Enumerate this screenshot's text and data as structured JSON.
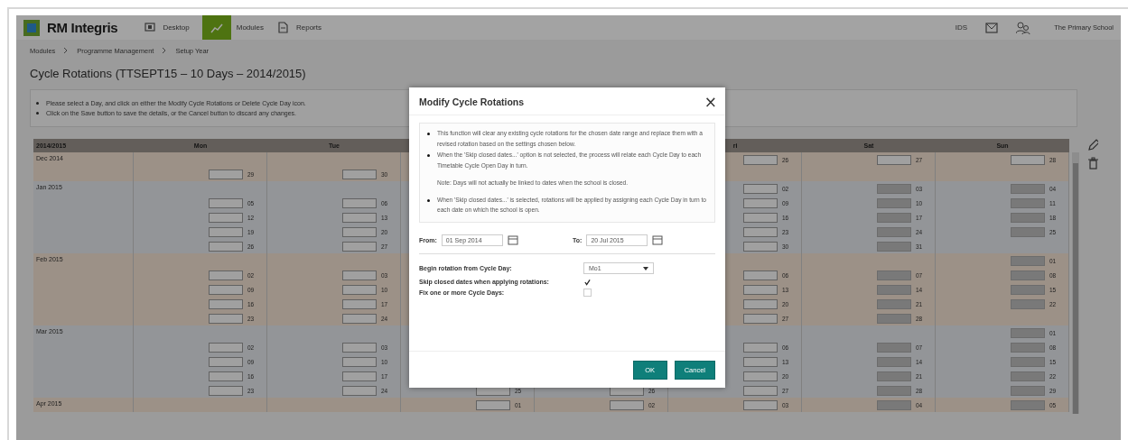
{
  "header": {
    "app_name": "RM Integris",
    "nav": [
      {
        "label": "Desktop",
        "kind": "desktop",
        "selected": false
      },
      {
        "label": "Modules",
        "kind": "modules",
        "selected": true
      },
      {
        "label": "Reports",
        "kind": "reports",
        "selected": false
      }
    ],
    "user_code": "IDS",
    "school": "The Primary School"
  },
  "breadcrumb": [
    "Modules",
    "Programme Management",
    "Setup Year"
  ],
  "page_title": "Cycle Rotations (TTSEPT15 – 10 Days – 2014/2015)",
  "instructions": [
    "Please select a Day, and click on either the Modify Cycle Rotations or Delete Cycle Day icon.",
    "Click on the Save button to save the details, or the Cancel button to discard any changes."
  ],
  "calendar": {
    "corner": "2014/2015",
    "columns": {
      "mon": "Mon",
      "tue": "Tue",
      "fri": "ri",
      "sat": "Sat",
      "sun": "Sun"
    },
    "months": [
      {
        "label": "Dec 2014",
        "weeks": [
          {
            "fri": {
              "day": "26",
              "closed": false
            },
            "sat": {
              "day": "27",
              "closed": false
            },
            "sun": {
              "day": "28",
              "closed": false
            }
          },
          {
            "mon": {
              "day": "29",
              "closed": false
            },
            "tue": {
              "day": "30",
              "closed": false
            }
          }
        ]
      },
      {
        "label": "Jan 2015",
        "weeks": [
          {
            "fri": {
              "day": "02",
              "closed": false
            },
            "sat": {
              "day": "03",
              "closed": true
            },
            "sun": {
              "day": "04",
              "closed": true
            }
          },
          {
            "mon": {
              "day": "05",
              "closed": false
            },
            "tue": {
              "day": "06",
              "closed": false
            },
            "fri": {
              "day": "09",
              "closed": false
            },
            "sat": {
              "day": "10",
              "closed": true
            },
            "sun": {
              "day": "11",
              "closed": true
            }
          },
          {
            "mon": {
              "day": "12",
              "closed": false
            },
            "tue": {
              "day": "13",
              "closed": false
            },
            "fri": {
              "day": "16",
              "closed": false
            },
            "sat": {
              "day": "17",
              "closed": true
            },
            "sun": {
              "day": "18",
              "closed": true
            }
          },
          {
            "mon": {
              "day": "19",
              "closed": false
            },
            "tue": {
              "day": "20",
              "closed": false
            },
            "fri": {
              "day": "23",
              "closed": false
            },
            "sat": {
              "day": "24",
              "closed": true
            },
            "sun": {
              "day": "25",
              "closed": true
            }
          },
          {
            "mon": {
              "day": "26",
              "closed": false
            },
            "tue": {
              "day": "27",
              "closed": false
            },
            "fri": {
              "day": "30",
              "closed": false
            },
            "sat": {
              "day": "31",
              "closed": true
            }
          }
        ]
      },
      {
        "label": "Feb 2015",
        "weeks": [
          {
            "sun": {
              "day": "01",
              "closed": true
            }
          },
          {
            "mon": {
              "day": "02",
              "closed": false
            },
            "tue": {
              "day": "03",
              "closed": false
            },
            "fri": {
              "day": "06",
              "closed": false
            },
            "sat": {
              "day": "07",
              "closed": true
            },
            "sun": {
              "day": "08",
              "closed": true
            }
          },
          {
            "mon": {
              "day": "09",
              "closed": false
            },
            "tue": {
              "day": "10",
              "closed": false
            },
            "fri": {
              "day": "13",
              "closed": false
            },
            "sat": {
              "day": "14",
              "closed": true
            },
            "sun": {
              "day": "15",
              "closed": true
            }
          },
          {
            "mon": {
              "day": "16",
              "closed": false
            },
            "tue": {
              "day": "17",
              "closed": false
            },
            "fri": {
              "day": "20",
              "closed": false
            },
            "sat": {
              "day": "21",
              "closed": true
            },
            "sun": {
              "day": "22",
              "closed": true
            }
          },
          {
            "mon": {
              "day": "23",
              "closed": false
            },
            "tue": {
              "day": "24",
              "closed": false
            },
            "fri": {
              "day": "27",
              "closed": false
            },
            "sat": {
              "day": "28",
              "closed": true
            }
          }
        ]
      },
      {
        "label": "Mar 2015",
        "weeks": [
          {
            "sun": {
              "day": "01",
              "closed": true
            }
          },
          {
            "mon": {
              "day": "02",
              "closed": false
            },
            "tue": {
              "day": "03",
              "closed": false
            },
            "fri": {
              "day": "06",
              "closed": false
            },
            "sat": {
              "day": "07",
              "closed": true
            },
            "sun": {
              "day": "08",
              "closed": true
            }
          },
          {
            "mon": {
              "day": "09",
              "closed": false
            },
            "tue": {
              "day": "10",
              "closed": false
            },
            "fri": {
              "day": "13",
              "closed": false
            },
            "sat": {
              "day": "14",
              "closed": true
            },
            "sun": {
              "day": "15",
              "closed": true
            }
          },
          {
            "mon": {
              "day": "16",
              "closed": false
            },
            "tue": {
              "day": "17",
              "closed": false
            },
            "fri": {
              "day": "20",
              "closed": false
            },
            "sat": {
              "day": "21",
              "closed": true
            },
            "sun": {
              "day": "22",
              "closed": true
            }
          },
          {
            "mon": {
              "day": "23",
              "closed": false
            },
            "tue": {
              "day": "24",
              "closed": false
            },
            "wed": {
              "day": "25",
              "closed": false
            },
            "thu": {
              "day": "26",
              "closed": false
            },
            "fri": {
              "day": "27",
              "closed": false
            },
            "sat": {
              "day": "28",
              "closed": true
            },
            "sun": {
              "day": "29",
              "closed": true
            }
          }
        ]
      },
      {
        "label": "Apr 2015",
        "weeks": [
          {
            "wed": {
              "day": "01",
              "closed": false
            },
            "thu": {
              "day": "02",
              "closed": false
            },
            "fri": {
              "day": "03",
              "closed": false
            },
            "sat": {
              "day": "04",
              "closed": true
            },
            "sun": {
              "day": "05",
              "closed": true
            }
          }
        ]
      }
    ]
  },
  "modal": {
    "title": "Modify Cycle Rotations",
    "close": "×",
    "info": [
      {
        "text": "This function will clear any existing cycle rotations for the chosen date range and replace them with a revised rotation based on the settings chosen below."
      },
      {
        "text": "When the 'Skip closed dates...' option is not selected, the process will relate each Cycle Day to each Timetable Cycle Open Day in turn.",
        "note": "Note: Days will not actually be linked to dates when the school is closed."
      },
      {
        "text": "When 'Skip closed dates...' is selected, rotations will be applied by assigning each Cycle Day in turn to each date on which the school is open."
      }
    ],
    "from_label": "From:",
    "from_value": "01 Sep 2014",
    "to_label": "To:",
    "to_value": "20 Jul 2015",
    "begin_label": "Begin rotation from Cycle Day:",
    "begin_value": "Mo1",
    "skip_label": "Skip closed dates when applying rotations:",
    "skip_checked": true,
    "fix_label": "Fix one or more Cycle Days:",
    "fix_checked": false,
    "buttons": [
      "OK",
      "Cancel"
    ]
  }
}
